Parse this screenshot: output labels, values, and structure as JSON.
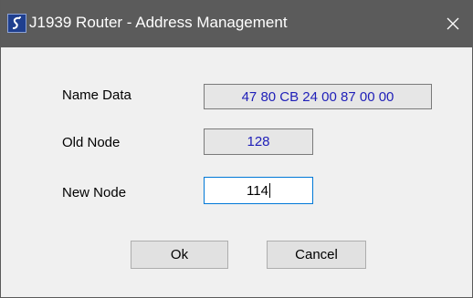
{
  "window": {
    "title": "J1939 Router - Address Management"
  },
  "form": {
    "name_data_label": "Name Data",
    "name_data_value": "47 80 CB 24 00 87 00 00",
    "old_node_label": "Old Node",
    "old_node_value": "128",
    "new_node_label": "New Node",
    "new_node_value": "114"
  },
  "buttons": {
    "ok_label": "Ok",
    "cancel_label": "Cancel"
  },
  "icons": {
    "app": "app-logo-icon",
    "close": "close-icon"
  },
  "colors": {
    "titlebar": "#5b5b5b",
    "readonly_text": "#1f1fb8",
    "focus_border": "#0078d7"
  }
}
